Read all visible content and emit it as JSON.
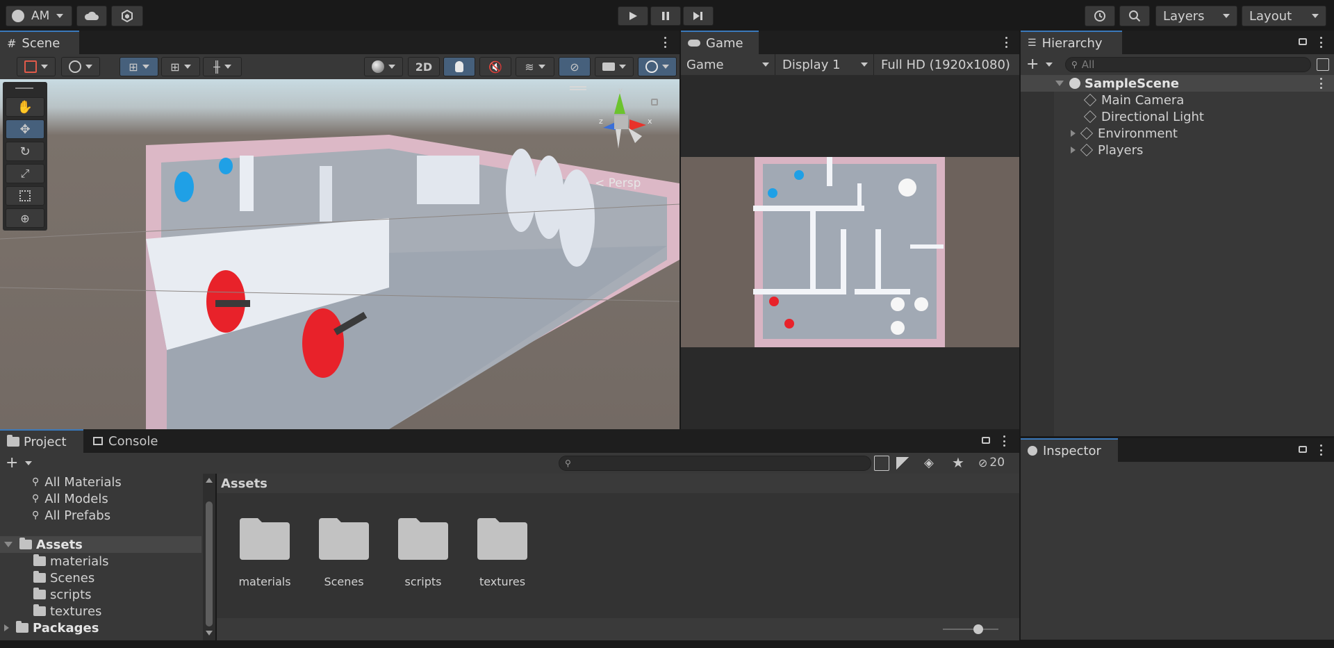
{
  "toolbar": {
    "account": "AM",
    "layers": "Layers",
    "layout": "Layout"
  },
  "scene": {
    "tab": "Scene",
    "btn_2d": "2D",
    "persp": "Persp"
  },
  "game": {
    "tab": "Game",
    "mode": "Game",
    "display": "Display 1",
    "resolution": "Full HD (1920x1080)"
  },
  "hierarchy": {
    "tab": "Hierarchy",
    "search_placeholder": "All",
    "scene_name": "SampleScene",
    "items": [
      {
        "label": "Main Camera"
      },
      {
        "label": "Directional Light"
      },
      {
        "label": "Environment"
      },
      {
        "label": "Players"
      }
    ]
  },
  "project": {
    "tab": "Project",
    "console_tab": "Console",
    "hidden_count": "20",
    "favorites": [
      "All Materials",
      "All Models",
      "All Prefabs"
    ],
    "assets_label": "Assets",
    "asset_folders": [
      "materials",
      "Scenes",
      "scripts",
      "textures"
    ],
    "packages_label": "Packages",
    "breadcrumb": "Assets",
    "grid_folders": [
      "materials",
      "Scenes",
      "scripts",
      "textures"
    ]
  },
  "inspector": {
    "tab": "Inspector"
  },
  "colors": {
    "accent": "#3a79bb",
    "selected": "#46607c",
    "player_red": "#e8222a",
    "player_blue": "#1fa0e6"
  }
}
